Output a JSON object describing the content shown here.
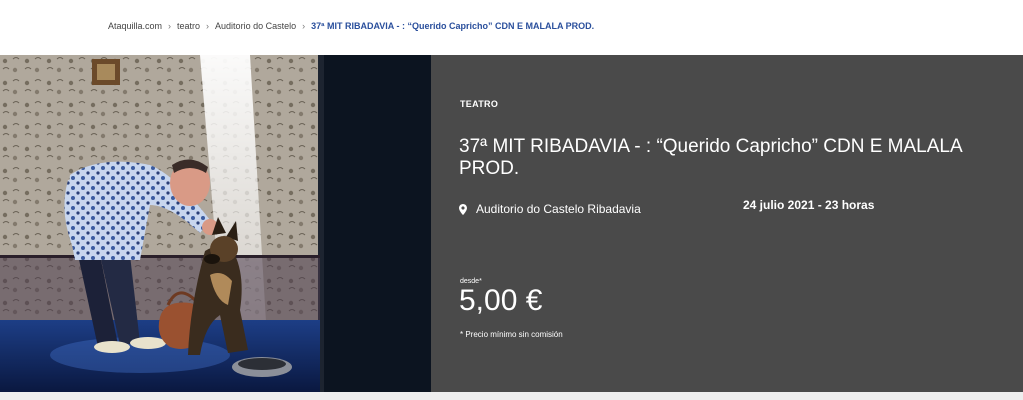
{
  "breadcrumb": {
    "items": [
      "Ataquilla.com",
      "teatro",
      "Auditorio do Castelo"
    ],
    "separator": "›",
    "current": "37ª MIT RIBADAVIA - : “Querido Capricho” CDN E MALALA PROD."
  },
  "event": {
    "category": "TEATRO",
    "title": "37ª MIT RIBADAVIA - : “Querido Capricho” CDN E MALALA PROD.",
    "venue": "Auditorio do Castelo Ribadavia",
    "datetime": "24 julio 2021 - 23 horas",
    "price_prefix": "desde*",
    "price": "5,00 €",
    "price_note": "* Precio mínimo sin comisión"
  },
  "colors": {
    "info_panel": "#4a4a4a",
    "breadcrumb_current": "#2a4f9c"
  },
  "icons": {
    "venue": "map-pin-icon"
  }
}
